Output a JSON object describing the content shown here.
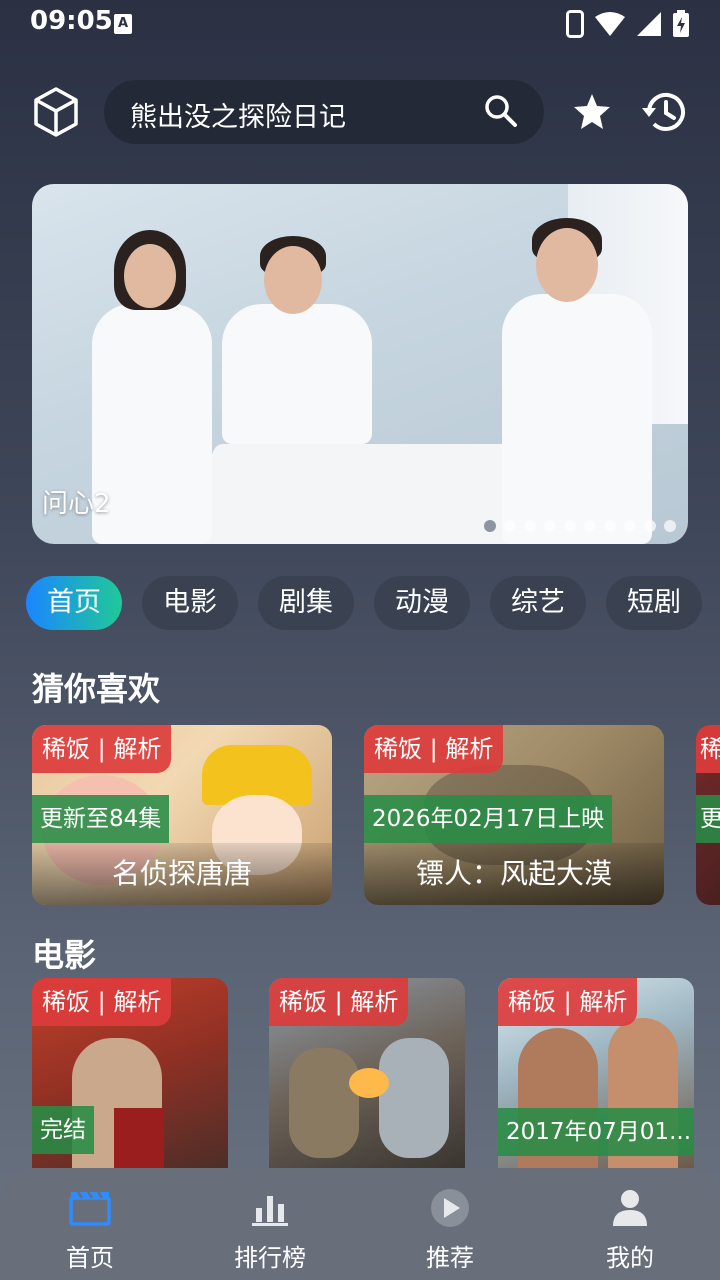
{
  "status_bar": {
    "time": "09:05",
    "notification_letter": "A"
  },
  "header": {
    "search_text": "熊出没之探险日记"
  },
  "banner": {
    "title": "问心2",
    "slide_count": 10,
    "active_index": 0
  },
  "tabs": [
    "首页",
    "电影",
    "剧集",
    "动漫",
    "综艺",
    "短剧"
  ],
  "active_tab": 0,
  "guess_section": {
    "title": "猜你喜欢",
    "cards": [
      {
        "badge": "稀饭 | 解析",
        "update": "更新至84集",
        "title": "名侦探唐唐"
      },
      {
        "badge": "稀饭 | 解析",
        "update": "2026年02月17日上映",
        "title": "镖人：风起大漠"
      },
      {
        "badge": "稀",
        "update": "更",
        "title": ""
      }
    ]
  },
  "movie_section": {
    "title": "电影",
    "cards": [
      {
        "badge": "稀饭 | 解析",
        "update": "完结"
      },
      {
        "badge": "稀饭 | 解析",
        "update": ""
      },
      {
        "badge": "稀饭 | 解析",
        "update": "2017年07月01..."
      }
    ]
  },
  "bottom_nav": [
    {
      "label": "首页",
      "icon": "clapperboard-icon",
      "active": true
    },
    {
      "label": "排行榜",
      "icon": "bar-chart-icon",
      "active": false
    },
    {
      "label": "推荐",
      "icon": "play-icon",
      "active": false
    },
    {
      "label": "我的",
      "icon": "user-icon",
      "active": false
    }
  ],
  "colors": {
    "accent_start": "#1a86ff",
    "accent_end": "#20c997",
    "badge_red": "#dc3c3c",
    "update_green": "#288c46",
    "nav_active_blue": "#2f8cff"
  }
}
